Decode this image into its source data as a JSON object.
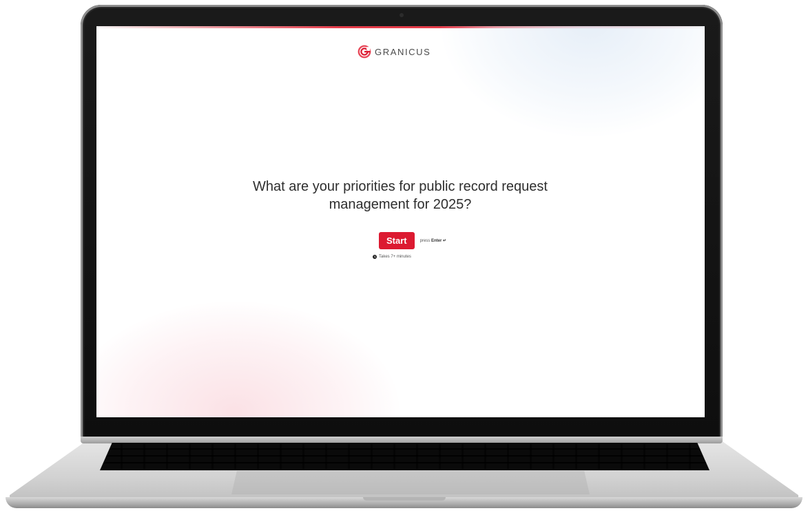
{
  "brand": {
    "name": "GRANICUS",
    "accent_color": "#dc1a31"
  },
  "form": {
    "question": "What are your priorities for public record request management for 2025?",
    "start_label": "Start",
    "enter_hint_prefix": "press",
    "enter_hint_key": "Enter ↵",
    "duration_text": "Takes 7+ minutes",
    "duration_icon": "clock-icon"
  }
}
